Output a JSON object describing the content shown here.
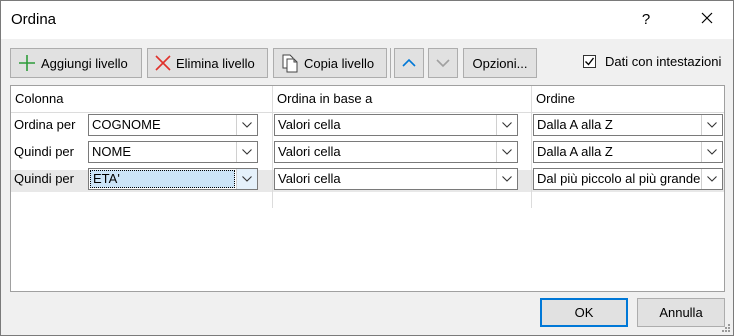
{
  "window": {
    "title": "Ordina",
    "help_label": "?"
  },
  "toolbar": {
    "add_level_label": "Aggiungi livello",
    "delete_level_label": "Elimina livello",
    "copy_level_label": "Copia livello",
    "options_label": "Opzioni...",
    "headers_checkbox_label": "Dati con intestazioni",
    "headers_checked": true
  },
  "grid": {
    "headers": {
      "column": "Colonna",
      "sort_on": "Ordina in base a",
      "order": "Ordine"
    },
    "rows": [
      {
        "label": "Ordina per",
        "column": "COGNOME",
        "sort_on": "Valori cella",
        "order": "Dalla A alla Z"
      },
      {
        "label": "Quindi per",
        "column": "NOME",
        "sort_on": "Valori cella",
        "order": "Dalla A alla Z"
      },
      {
        "label": "Quindi per",
        "column": "ETA'",
        "sort_on": "Valori cella",
        "order": "Dal più piccolo al più grande"
      }
    ]
  },
  "footer": {
    "ok_label": "OK",
    "cancel_label": "Annulla"
  },
  "colors": {
    "accent": "#0078d7",
    "add_icon": "#2e9c3a",
    "delete_icon": "#e0312b",
    "selected_value_bg": "#cce4f7"
  }
}
